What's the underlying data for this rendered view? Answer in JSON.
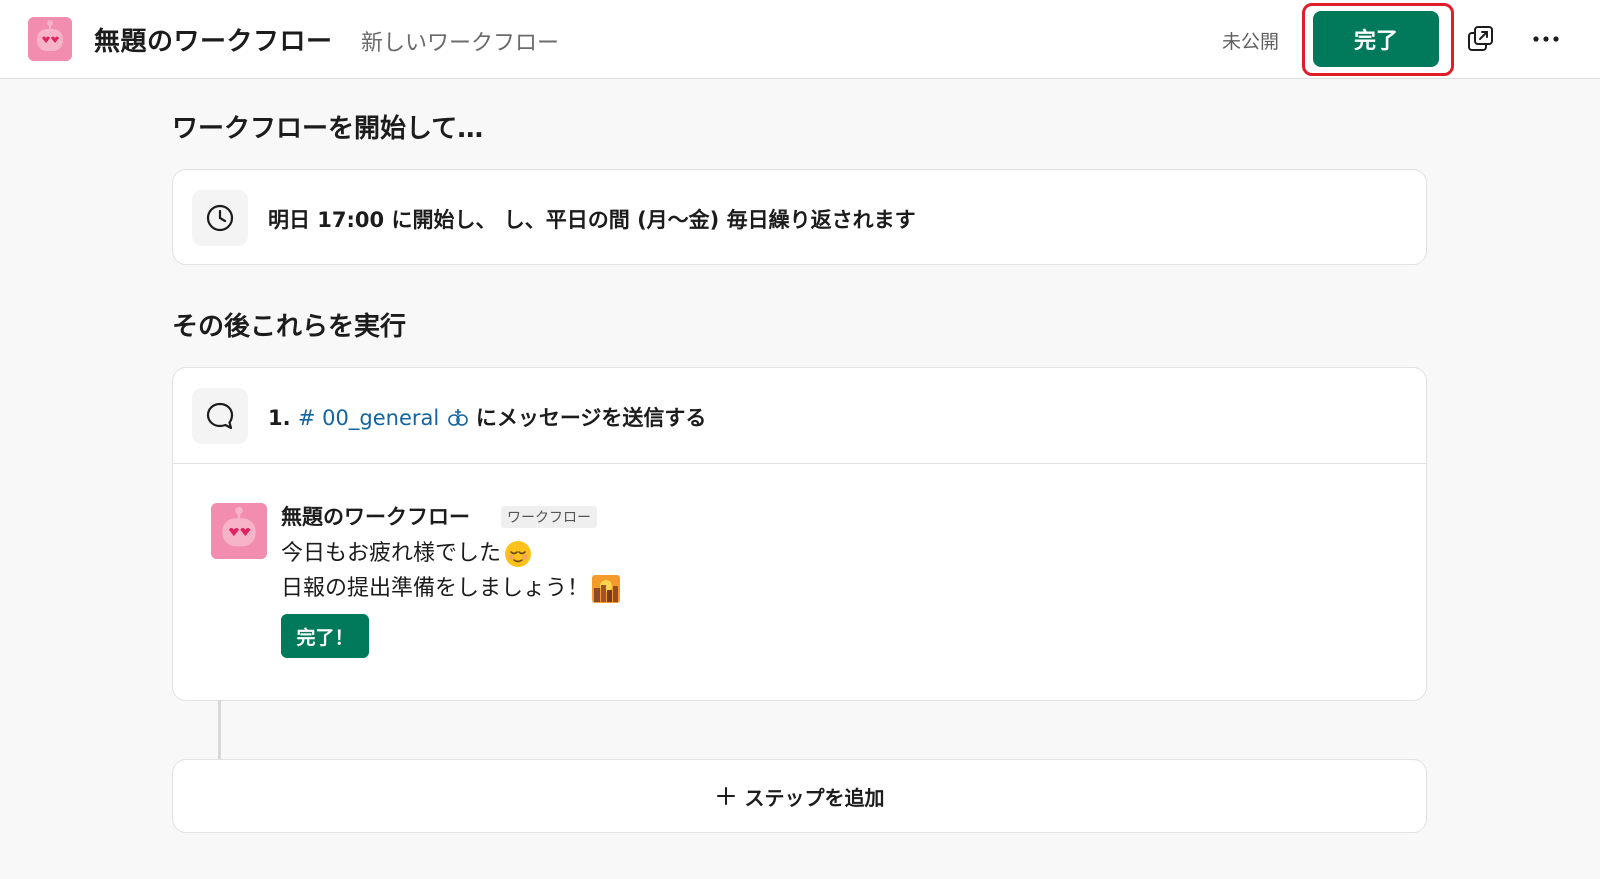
{
  "header": {
    "title": "無題のワークフロー",
    "subtitle": "新しいワークフロー",
    "status": "未公開",
    "done_label": "完了"
  },
  "trigger": {
    "heading": "ワークフローを開始して…",
    "text": "明日 17:00 に開始し、 し、平日の間 (月〜金) 毎日繰り返されます",
    "icon": "clock-icon"
  },
  "steps": {
    "heading": "その後これらを実行",
    "step1": {
      "number": "1.",
      "channel": "# 00_general",
      "action": "にメッセージを送信する",
      "icon": "speech-bubble-icon"
    },
    "message": {
      "sender": "無題のワークフロー",
      "tag": "ワークフロー",
      "line1": "今日もお疲れ様でした",
      "line2": "日報の提出準備をしましょう！",
      "button_label": "完了！"
    }
  },
  "add_step": {
    "label": "ステップを追加"
  },
  "colors": {
    "accent_green": "#007a5a",
    "highlight_red": "#e01e2a",
    "link_blue": "#1264a3",
    "avatar_pink": "#f28db0"
  }
}
